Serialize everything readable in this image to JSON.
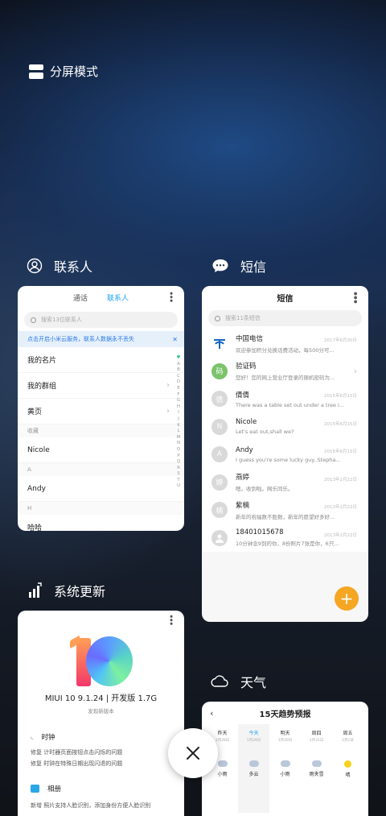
{
  "split_screen": {
    "label": "分屏模式",
    "icon": "split-screen-icon"
  },
  "apps": {
    "contacts": {
      "title": "联系人",
      "icon": "person-icon",
      "tabs": [
        "通话",
        "联系人"
      ],
      "active_tab": "联系人",
      "search_placeholder": "搜索13位联系人",
      "banner": "点击开启小米云服务，联系人数据永不丢失",
      "rows": [
        {
          "type": "row",
          "label": "我的名片",
          "chev": false
        },
        {
          "type": "row",
          "label": "我的群组",
          "chev": true
        },
        {
          "type": "row",
          "label": "黄页",
          "chev": true
        },
        {
          "type": "section",
          "label": "收藏"
        },
        {
          "type": "row",
          "label": "Nicole",
          "chev": false
        },
        {
          "type": "section",
          "label": "A"
        },
        {
          "type": "row",
          "label": "Andy",
          "chev": false
        },
        {
          "type": "section",
          "label": "H"
        },
        {
          "type": "row",
          "label": "哈哈",
          "chev": false
        }
      ],
      "alphabet": [
        "♥",
        "A",
        "B",
        "C",
        "D",
        "E",
        "F",
        "G",
        "H",
        "I",
        "J",
        "K",
        "L",
        "M",
        "N",
        "O",
        "P",
        "Q",
        "R",
        "S",
        "T",
        "U"
      ]
    },
    "messages": {
      "title": "短信",
      "icon": "message-icon",
      "header": "短信",
      "search_placeholder": "搜索11条短信",
      "threads": [
        {
          "avatar": "",
          "avatar_color": "#1565c0",
          "name": "中国电信",
          "snippet": "欢迎参加积分兑换话费活动，每500分可...",
          "date": "2017年6月30日"
        },
        {
          "avatar": "码",
          "avatar_color": "#7cc36b",
          "name": "验证码",
          "snippet": "您好！您的网上营业厅登录的随机密码为...",
          "date": ""
        },
        {
          "avatar": "倩",
          "avatar_color": "#d9d9d9",
          "name": "倩倩",
          "snippet": "There was a table set out under a tree i...",
          "date": "2015年6月15日"
        },
        {
          "avatar": "N",
          "avatar_color": "#d9d9d9",
          "name": "Nicole",
          "snippet": "Let's eat out,shall we?",
          "date": "2015年6月15日"
        },
        {
          "avatar": "A",
          "avatar_color": "#d9d9d9",
          "name": "Andy",
          "snippet": "I guess you're some lucky guy..Stepha...",
          "date": "2015年6月15日"
        },
        {
          "avatar": "婷",
          "avatar_color": "#d9d9d9",
          "name": "燕婷",
          "snippet": "嗯。收到啦。网乐同乐。",
          "date": "2013年2月22日"
        },
        {
          "avatar": "楠",
          "avatar_color": "#d9d9d9",
          "name": "紫楠",
          "snippet": "新年的祝福数不胜数，新年的愿望好多好...",
          "date": "2013年2月22日"
        },
        {
          "avatar": "",
          "avatar_color": "#d9d9d9",
          "name": "18401015678",
          "snippet": "10分钟念9到的你，8份照片7张是你，6只...",
          "date": "2013年2月22日"
        }
      ],
      "fab": "+"
    },
    "update": {
      "title": "系统更新",
      "icon": "update-icon",
      "version": "MIUI 10 9.1.24 | 开发版 1.7G",
      "subtitle": "发现新版本",
      "sections": [
        {
          "name": "时钟",
          "icon": "clock-icon",
          "lines": [
            "修复 计时器页面按钮点击闪烁的问题",
            "修复 时钟在特殊日期出现闪退的问题"
          ]
        },
        {
          "name": "相册",
          "icon": "gallery-icon",
          "lines": [
            "新增 照片支持人脸识别，添加身份方便人脸识别"
          ]
        }
      ]
    },
    "weather": {
      "title": "天气",
      "icon": "cloud-icon",
      "header": "15天趋势预报",
      "days": [
        {
          "day": "昨天",
          "date": "1月28日",
          "weather": "小雨",
          "icon": "rain",
          "today": false
        },
        {
          "day": "今天",
          "date": "1月29日",
          "weather": "多云",
          "icon": "cloud",
          "today": true
        },
        {
          "day": "明天",
          "date": "1月30日",
          "weather": "小雨",
          "icon": "rain",
          "today": false
        },
        {
          "day": "周四",
          "date": "1月31日",
          "weather": "雨夹雪",
          "icon": "sleet",
          "today": false
        },
        {
          "day": "周五",
          "date": "2月1日",
          "weather": "晴",
          "icon": "sun",
          "today": false
        }
      ]
    }
  },
  "close_button": "×"
}
